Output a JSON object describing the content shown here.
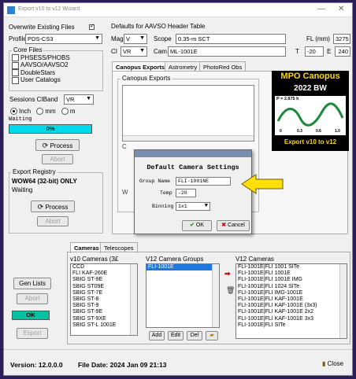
{
  "window": {
    "title": "Export v10 to v12 Wizard",
    "minimize": "—",
    "close": "✕"
  },
  "left": {
    "overwrite_label": "Overwrite Existing Files",
    "profile_label": "Profile",
    "profile_value": "PDS-CS3",
    "core_files_title": "Core Files",
    "core_files": [
      "PHSESS/PHOBS",
      "AAVSO/AAVSO2",
      "DoubleStars",
      "User Catalogs"
    ],
    "sessions_label": "Sessions CIBand",
    "sessions_value": "VR",
    "units": [
      "Inch",
      "mm",
      "m"
    ],
    "status_text": "Waiting",
    "progress_text": "0%",
    "process_label": "Process",
    "abort_label": "Abort",
    "registry_title": "Export Registry",
    "registry_heading": "WOW64 (32-bit) ONLY",
    "registry_status": "Waiting",
    "registry_process_label": "Process",
    "registry_abort_label": "Abort",
    "gen_lists_label": "Gen Lists",
    "abort3_label": "Abort",
    "ok_status": "OK",
    "export_label": "Export"
  },
  "aavso": {
    "title": "Defaults for AAVSO Header Table",
    "mag_label": "Mag",
    "mag_value": "V",
    "scope_label": "Scope",
    "scope_value": "0.35-m SCT",
    "fl_label": "FL (mm)",
    "fl_value": "3275",
    "ci_label": "CI",
    "ci_value": "VR",
    "cam_label": "Cam",
    "cam_value": "ML-1001E",
    "t_label": "T",
    "t_value": "-20",
    "e_label": "E",
    "e_value": "240"
  },
  "tabs": [
    "Canopus Exports",
    "Astrometry",
    "PhotoRed Obs"
  ],
  "canopus_exports_title": "Canopus Exports",
  "logo": {
    "title": "MPO Canopus",
    "subtitle": "2022 BW",
    "period": "P = 2.875 h",
    "ticks": [
      "0",
      "0.3",
      "0.6",
      "1.0"
    ],
    "caption": "Export v10 to v12",
    "accent": "#ffd700"
  },
  "dialog": {
    "title": "Default Camera Settings",
    "group_label": "Group Name",
    "group_value": "FLI-1001NE",
    "temp_label": "Temp",
    "temp_value": "-20",
    "binning_label": "Binning",
    "binning_value": "1x1",
    "ok_label": "OK",
    "cancel_label": "Cancel"
  },
  "bottom_tabs": [
    "Cameras",
    "Telescopes"
  ],
  "cameras": {
    "v10_title": "v10 Cameras (3£",
    "v10_list": [
      "CCD",
      "FLI KAF-260E",
      "SBIG ST-9E",
      "SBIG ST09E",
      "SBIG ST-7E",
      "SBIG ST-8",
      "SBIG ST-9",
      "SBIG ST-9E",
      "SBIG ST-9XE",
      "SBIG ST-L 1001E"
    ],
    "v12_groups_title": "V12 Camera Groups",
    "v12_groups": [
      "FLI-1001E"
    ],
    "v12_cams_title": "V12 Cameras",
    "v12_cams": [
      "FLI-1001E|FLI 1001 SITe",
      "FLI-1001E|FLI 1001E",
      "FLI-1001E|FLI 1001E IMG",
      "FLI-1001E|FLI 1024 SITe",
      "FLI-1001E|FLI IMG-1001E",
      "FLI-1001E|FLI KAF-1001E",
      "FLI-1001E|FLI KAF-1001E (3x3)",
      "FLI-1001E|FLI KAF-1001E 2x2",
      "FLI-1001E|FLI KAF-1001E 3x3",
      "FLI-1001E|FLI SITe"
    ],
    "add_label": "Add",
    "edit_label": "Edit",
    "del_label": "Del"
  },
  "footer": {
    "version": "Version: 12.0.0.0",
    "file_date": "File Date: 2024 Jan 09  21:13",
    "close_label": "Close"
  }
}
